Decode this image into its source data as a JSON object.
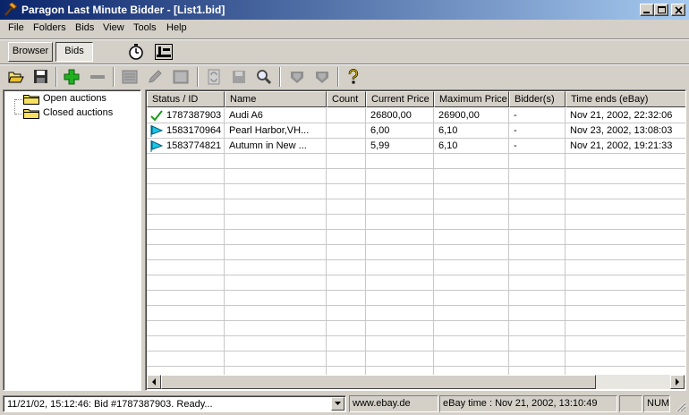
{
  "window": {
    "title": "Paragon Last Minute Bidder - [List1.bid]"
  },
  "menu": [
    "File",
    "Folders",
    "Bids",
    "View",
    "Tools",
    "Help"
  ],
  "view_tabs": {
    "browser": "Browser",
    "bids": "Bids"
  },
  "tree": {
    "items": [
      "Open auctions",
      "Closed auctions"
    ]
  },
  "table": {
    "columns": [
      "Status / ID",
      "Name",
      "Count",
      "Current Price",
      "Maximum Price",
      "Bidder(s)",
      "Time ends (eBay)"
    ],
    "rows": [
      {
        "status": "check-icon",
        "id": "1787387903",
        "name": "Audi A6",
        "count": "",
        "current": "26800,00",
        "maximum": "26900,00",
        "bidders": "-",
        "ends": "Nov 21, 2002, 22:32:06"
      },
      {
        "status": "flag-icon",
        "id": "1583170964",
        "name": "Pearl Harbor,VH...",
        "count": "",
        "current": "6,00",
        "maximum": "6,10",
        "bidders": "-",
        "ends": "Nov 23, 2002, 13:08:03"
      },
      {
        "status": "flag-icon",
        "id": "1583774821",
        "name": "Autumn in New ...",
        "count": "",
        "current": "5,99",
        "maximum": "6,10",
        "bidders": "-",
        "ends": "Nov 21, 2002, 19:21:33"
      }
    ]
  },
  "status": {
    "message": "11/21/02, 15:12:46: Bid #1787387903. Ready...",
    "site": "www.ebay.de",
    "ebay_time": "eBay time : Nov 21, 2002, 13:10:49",
    "num": "NUM"
  },
  "colors": {
    "title_start": "#0a246a",
    "title_end": "#a6caf0",
    "check": "#1a9a1a",
    "flag": "#18c8e8",
    "add": "#20b020"
  }
}
